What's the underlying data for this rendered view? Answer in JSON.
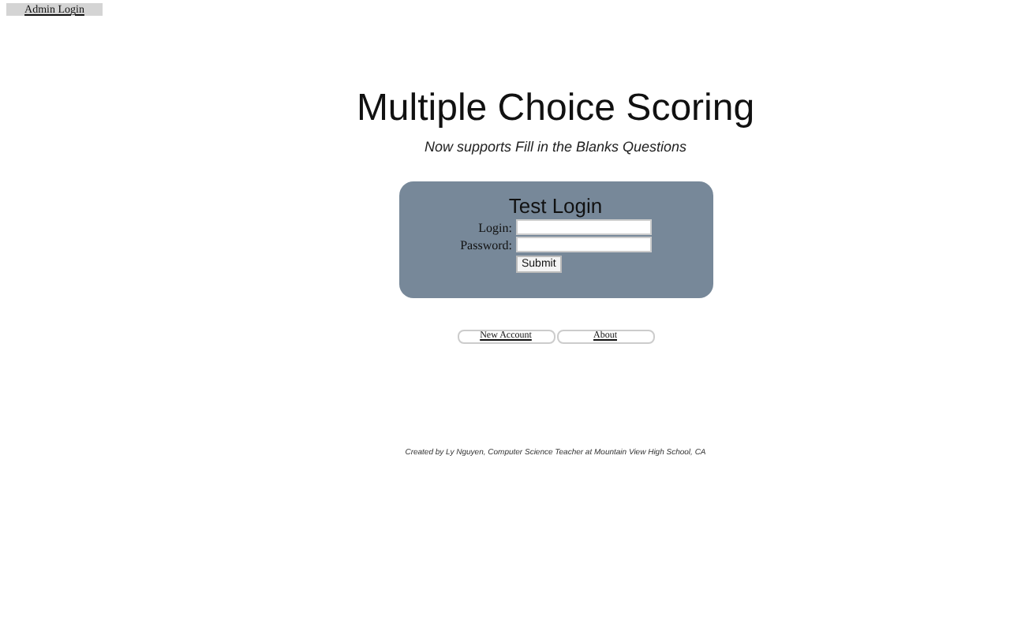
{
  "admin_button": "Admin Login",
  "title": "Multiple Choice Scoring",
  "subtitle": "Now supports Fill in the Blanks Questions",
  "login_panel": {
    "title": "Test Login",
    "fields": [
      {
        "label": "Login:"
      },
      {
        "label": "Password:"
      }
    ],
    "submit": "Submit"
  },
  "links": [
    "New Account",
    "About"
  ],
  "footer": "Created by Ly Nguyen, Computer Science Teacher at Mountain View High School, CA"
}
